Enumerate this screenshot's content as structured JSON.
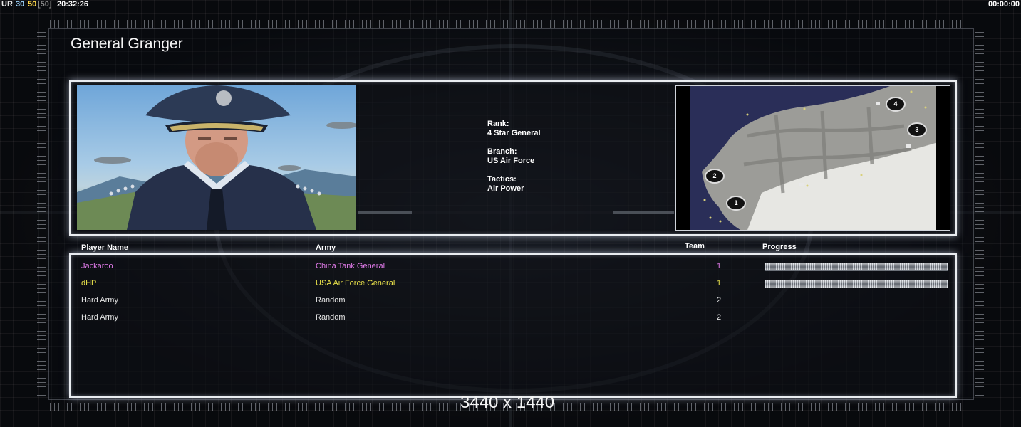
{
  "overlay": {
    "ur": "UR",
    "fps": "30",
    "fps_limit": "50",
    "fps_max": "[50]",
    "clock": "20:32:26",
    "timer": "00:00:00"
  },
  "general": {
    "name": "General Granger",
    "rank_label": "Rank:",
    "rank_value": "4 Star General",
    "branch_label": "Branch:",
    "branch_value": "US Air Force",
    "tactics_label": "Tactics:",
    "tactics_value": "Air Power"
  },
  "minimap": {
    "start_positions": [
      "1",
      "2",
      "3",
      "4"
    ]
  },
  "players_table": {
    "headers": {
      "name": "Player Name",
      "army": "Army",
      "team": "Team",
      "progress": "Progress"
    },
    "rows": [
      {
        "name": "Jackaroo",
        "army": "China Tank General",
        "team": "1",
        "color": "#e07ae8",
        "progress": 1.0
      },
      {
        "name": "dHP",
        "army": "USA Air Force General",
        "team": "1",
        "color": "#e8e04a",
        "progress": 1.0
      },
      {
        "name": "Hard Army",
        "army": "Random",
        "team": "2",
        "color": "#e6e6e6",
        "progress": null
      },
      {
        "name": "Hard Army",
        "army": "Random",
        "team": "2",
        "color": "#e6e6e6",
        "progress": null
      }
    ]
  },
  "footer": {
    "resolution": "3440 x 1440"
  }
}
